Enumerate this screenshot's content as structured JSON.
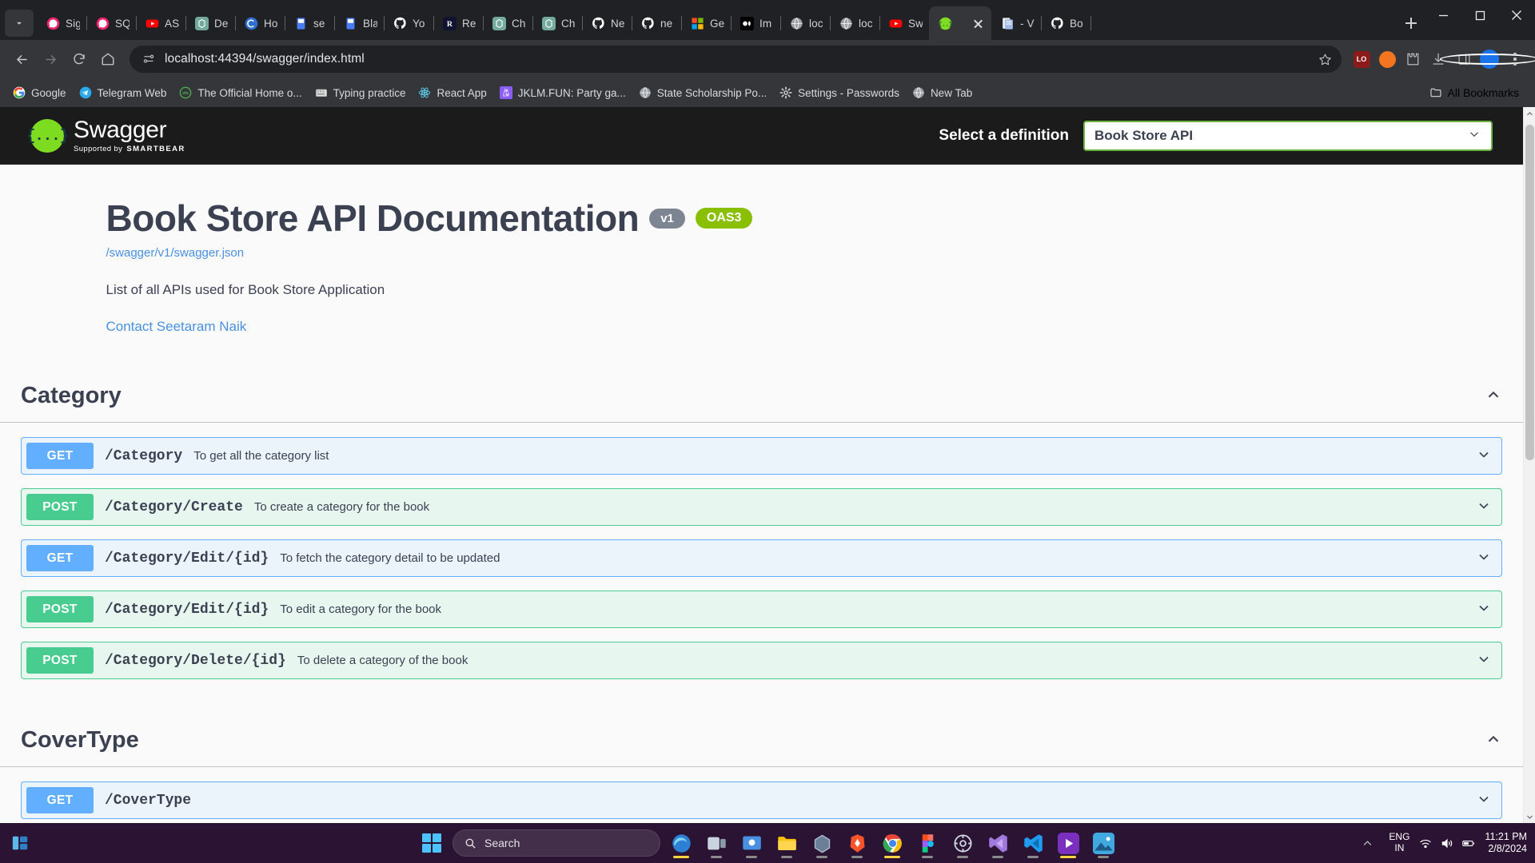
{
  "browser": {
    "tabs": [
      {
        "label": "Sig",
        "icon": "signal-icon",
        "color": "#e91e63",
        "active": false
      },
      {
        "label": "SQ",
        "icon": "signal-icon",
        "color": "#e91e63",
        "active": false
      },
      {
        "label": "AS",
        "icon": "youtube-icon",
        "color": "#ff0000",
        "active": false
      },
      {
        "label": "De",
        "icon": "openai-icon",
        "color": "#74aa9c",
        "active": false
      },
      {
        "label": "Ho",
        "icon": "copilot-icon",
        "color": "#3a7bd5",
        "active": false
      },
      {
        "label": "se",
        "icon": "bluebook-icon",
        "color": "#4a7bf7",
        "active": false
      },
      {
        "label": "Bla",
        "icon": "bluebook-icon",
        "color": "#4a7bf7",
        "active": false
      },
      {
        "label": "Yo",
        "icon": "github-icon",
        "color": "#ffffff",
        "active": false
      },
      {
        "label": "Re",
        "icon": "react-router-icon",
        "color": "#1a1a3a",
        "active": false
      },
      {
        "label": "Ch",
        "icon": "openai-icon",
        "color": "#74aa9c",
        "active": false
      },
      {
        "label": "Ch",
        "icon": "openai-icon",
        "color": "#74aa9c",
        "active": false
      },
      {
        "label": "Ne",
        "icon": "github-icon",
        "color": "#ffffff",
        "active": false
      },
      {
        "label": "ne",
        "icon": "github-icon",
        "color": "#ffffff",
        "active": false
      },
      {
        "label": "Ge",
        "icon": "microsoft-icon",
        "color": "#f25022",
        "active": false
      },
      {
        "label": "Im",
        "icon": "medium-icon",
        "color": "#000000",
        "active": false
      },
      {
        "label": "loc",
        "icon": "globe-icon",
        "color": "#9aa0a6",
        "active": false
      },
      {
        "label": "loc",
        "icon": "globe-icon",
        "color": "#9aa0a6",
        "active": false
      },
      {
        "label": "Sw",
        "icon": "youtube-icon",
        "color": "#ff0000",
        "active": false
      },
      {
        "label": "",
        "icon": "swagger-icon",
        "color": "#7ddc1f",
        "active": true
      },
      {
        "label": "- V",
        "icon": "document-icon",
        "color": "#4a7bf7",
        "active": false
      },
      {
        "label": "Bo",
        "icon": "github-icon",
        "color": "#ffffff",
        "active": false
      }
    ],
    "new_tab_label": "New tab",
    "window_controls": {
      "minimize": "minimize-button",
      "maximize": "maximize-button",
      "close": "close-button"
    },
    "toolbar": {
      "back_label": "Back",
      "forward_label": "Forward",
      "reload_label": "Reload",
      "home_label": "Home",
      "url": "localhost:44394/swagger/index.html",
      "bookmark_label": "Bookmark this tab",
      "extension_lo": "LO",
      "download_label": "Downloads",
      "sidepanel_label": "Side panel",
      "profile_label": "Profile",
      "menu_label": "Customize and control"
    },
    "bookmarks": [
      {
        "label": "Google",
        "icon": "google-icon"
      },
      {
        "label": "Telegram Web",
        "icon": "telegram-icon"
      },
      {
        "label": "The Official Home o...",
        "icon": "vts-icon"
      },
      {
        "label": "Typing practice",
        "icon": "keyboard-icon"
      },
      {
        "label": "React App",
        "icon": "react-icon"
      },
      {
        "label": "JKLM.FUN: Party ga...",
        "icon": "jklm-icon"
      },
      {
        "label": "State Scholarship Po...",
        "icon": "globe-icon"
      },
      {
        "label": "Settings - Passwords",
        "icon": "gear-icon"
      },
      {
        "label": "New Tab",
        "icon": "globe-icon"
      }
    ],
    "all_bookmarks_label": "All Bookmarks"
  },
  "swagger": {
    "logo": {
      "title": "Swagger",
      "supported_by": "Supported by",
      "brand": "SMARTBEAR",
      "mark": "{...}"
    },
    "select_definition_label": "Select a definition",
    "selected_definition": "Book Store API",
    "info": {
      "title": "Book Store API Documentation",
      "version_badge": "v1",
      "oas_badge": "OAS3",
      "json_url": "/swagger/v1/swagger.json",
      "description": "List of all APIs used for Book Store Application",
      "contact": "Contact Seetaram Naik"
    },
    "sections": [
      {
        "name": "Category",
        "expanded": true,
        "operations": [
          {
            "method": "GET",
            "path": "/Category",
            "summary": "To get all the category list"
          },
          {
            "method": "POST",
            "path": "/Category/Create",
            "summary": "To create a category for the book"
          },
          {
            "method": "GET",
            "path": "/Category/Edit/{id}",
            "summary": "To fetch the category detail to be updated"
          },
          {
            "method": "POST",
            "path": "/Category/Edit/{id}",
            "summary": "To edit a category for the book"
          },
          {
            "method": "POST",
            "path": "/Category/Delete/{id}",
            "summary": "To delete a category of the book"
          }
        ]
      },
      {
        "name": "CoverType",
        "expanded": true,
        "operations": [
          {
            "method": "GET",
            "path": "/CoverType",
            "summary": ""
          }
        ]
      }
    ]
  },
  "taskbar": {
    "start_label": "Start",
    "search_placeholder": "Search",
    "apps": [
      {
        "name": "edge-dev",
        "color": "#2d7fd3",
        "active": true
      },
      {
        "name": "task-view",
        "color": "#8a9aa8",
        "active": false
      },
      {
        "name": "teams",
        "color": "#4a90e2",
        "active": false
      },
      {
        "name": "file-explorer",
        "color": "#ffc107",
        "active": false
      },
      {
        "name": "store",
        "color": "#5a6f8a",
        "active": false
      },
      {
        "name": "brave",
        "color": "#fb542b",
        "active": false
      },
      {
        "name": "chrome",
        "color": "#4285f4",
        "active": true
      },
      {
        "name": "figma",
        "color": "#f24e1e",
        "active": false
      },
      {
        "name": "settings",
        "color": "#5c6b7a",
        "active": false
      },
      {
        "name": "visual-studio",
        "color": "#a179dc",
        "active": false
      },
      {
        "name": "vscode",
        "color": "#1f9cf0",
        "active": false
      },
      {
        "name": "media-player",
        "color": "#7b2fbe",
        "active": true
      },
      {
        "name": "photos",
        "color": "#2e9dd6",
        "active": false
      }
    ],
    "language": "ENG",
    "region": "IN",
    "time": "11:21 PM",
    "date": "2/8/2024"
  }
}
